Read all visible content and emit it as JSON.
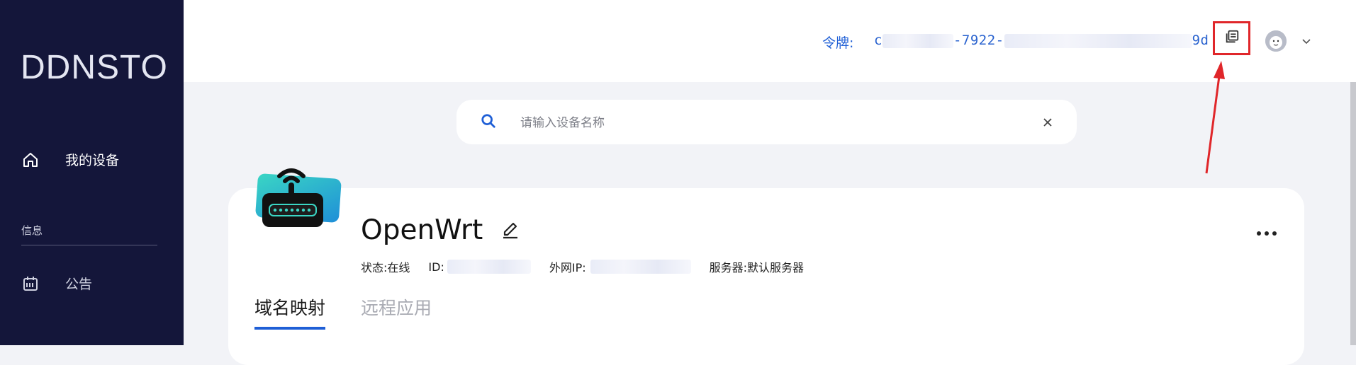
{
  "sidebar": {
    "logo": "DDNSTO",
    "items": [
      {
        "label": "我的设备",
        "icon": "home-icon"
      },
      {
        "label": "公告",
        "icon": "calendar-icon"
      }
    ],
    "section_label": "信息"
  },
  "header": {
    "token_label": "令牌:",
    "token_visible_start": "c",
    "token_visible_mid": "-7922-",
    "token_visible_end": "9d",
    "copy_icon": "copy-icon",
    "avatar_icon": "avatar",
    "caret_icon": "chevron-down-icon"
  },
  "search": {
    "placeholder": "请输入设备名称",
    "value": ""
  },
  "device": {
    "name": "OpenWrt",
    "status_label": "状态:",
    "status_value": "在线",
    "id_label": "ID:",
    "ip_label": "外网IP:",
    "server_label": "服务器:",
    "server_value": "默认服务器"
  },
  "tabs": [
    {
      "label": "域名映射",
      "active": true
    },
    {
      "label": "远程应用",
      "active": false
    }
  ],
  "colors": {
    "sidebar_bg": "#14163a",
    "accent": "#1f5fd6",
    "highlight_red": "#e0262a",
    "page_bg": "#f2f3f7"
  }
}
